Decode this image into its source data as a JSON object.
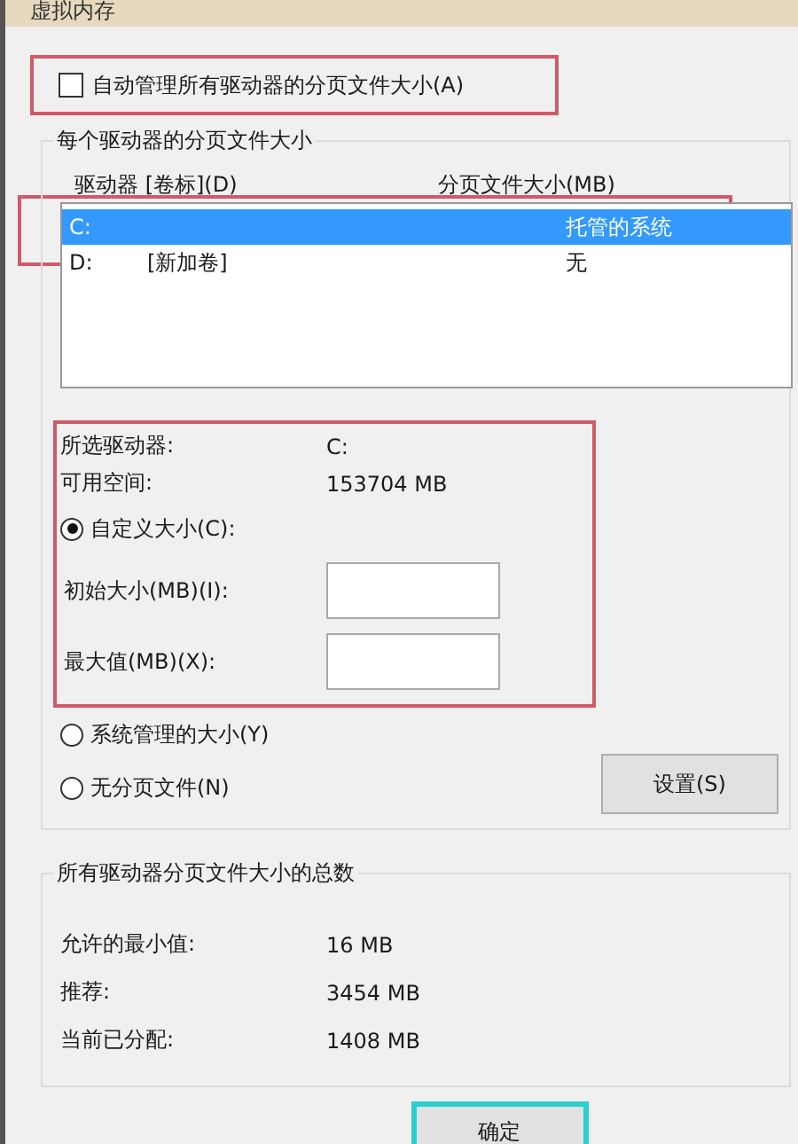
{
  "window": {
    "title": "虚拟内存"
  },
  "auto_manage": {
    "label": "自动管理所有驱动器的分页文件大小(A)",
    "checked": false,
    "highlighted": true
  },
  "per_drive": {
    "title": "每个驱动器的分页文件大小",
    "columns": [
      "驱动器 [卷标](D)",
      "分页文件大小(MB)"
    ],
    "rows": [
      {
        "drive": "C:",
        "label": "",
        "size": "托管的系统",
        "selected": true,
        "highlighted": true
      },
      {
        "drive": "D:",
        "label": "[新加卷]",
        "size": "无",
        "selected": false
      }
    ],
    "details": {
      "highlighted": true,
      "selected_drive_label": "所选驱动器:",
      "selected_drive": "C:",
      "free_space_label": "可用空间:",
      "free_space": "153704 MB"
    },
    "options": [
      {
        "label": "自定义大小(C):",
        "selected": true
      },
      {
        "label": "系统管理的大小(Y)",
        "selected": false
      },
      {
        "label": "无分页文件(N)",
        "selected": false
      }
    ],
    "fields": [
      {
        "label": "初始大小(MB)(I):"
      },
      {
        "label": "最大值(MB)(X):"
      }
    ],
    "set_button": "设置(S)"
  },
  "totals": {
    "title": "所有驱动器分页文件大小的总数",
    "rows": [
      {
        "label": "允许的最小值:",
        "value": "16 MB"
      },
      {
        "label": "推荐:",
        "value": "3454 MB"
      },
      {
        "label": "当前已分配:",
        "value": "1408 MB"
      }
    ]
  },
  "buttons": [
    {
      "label": "确定",
      "focused": true
    }
  ]
}
